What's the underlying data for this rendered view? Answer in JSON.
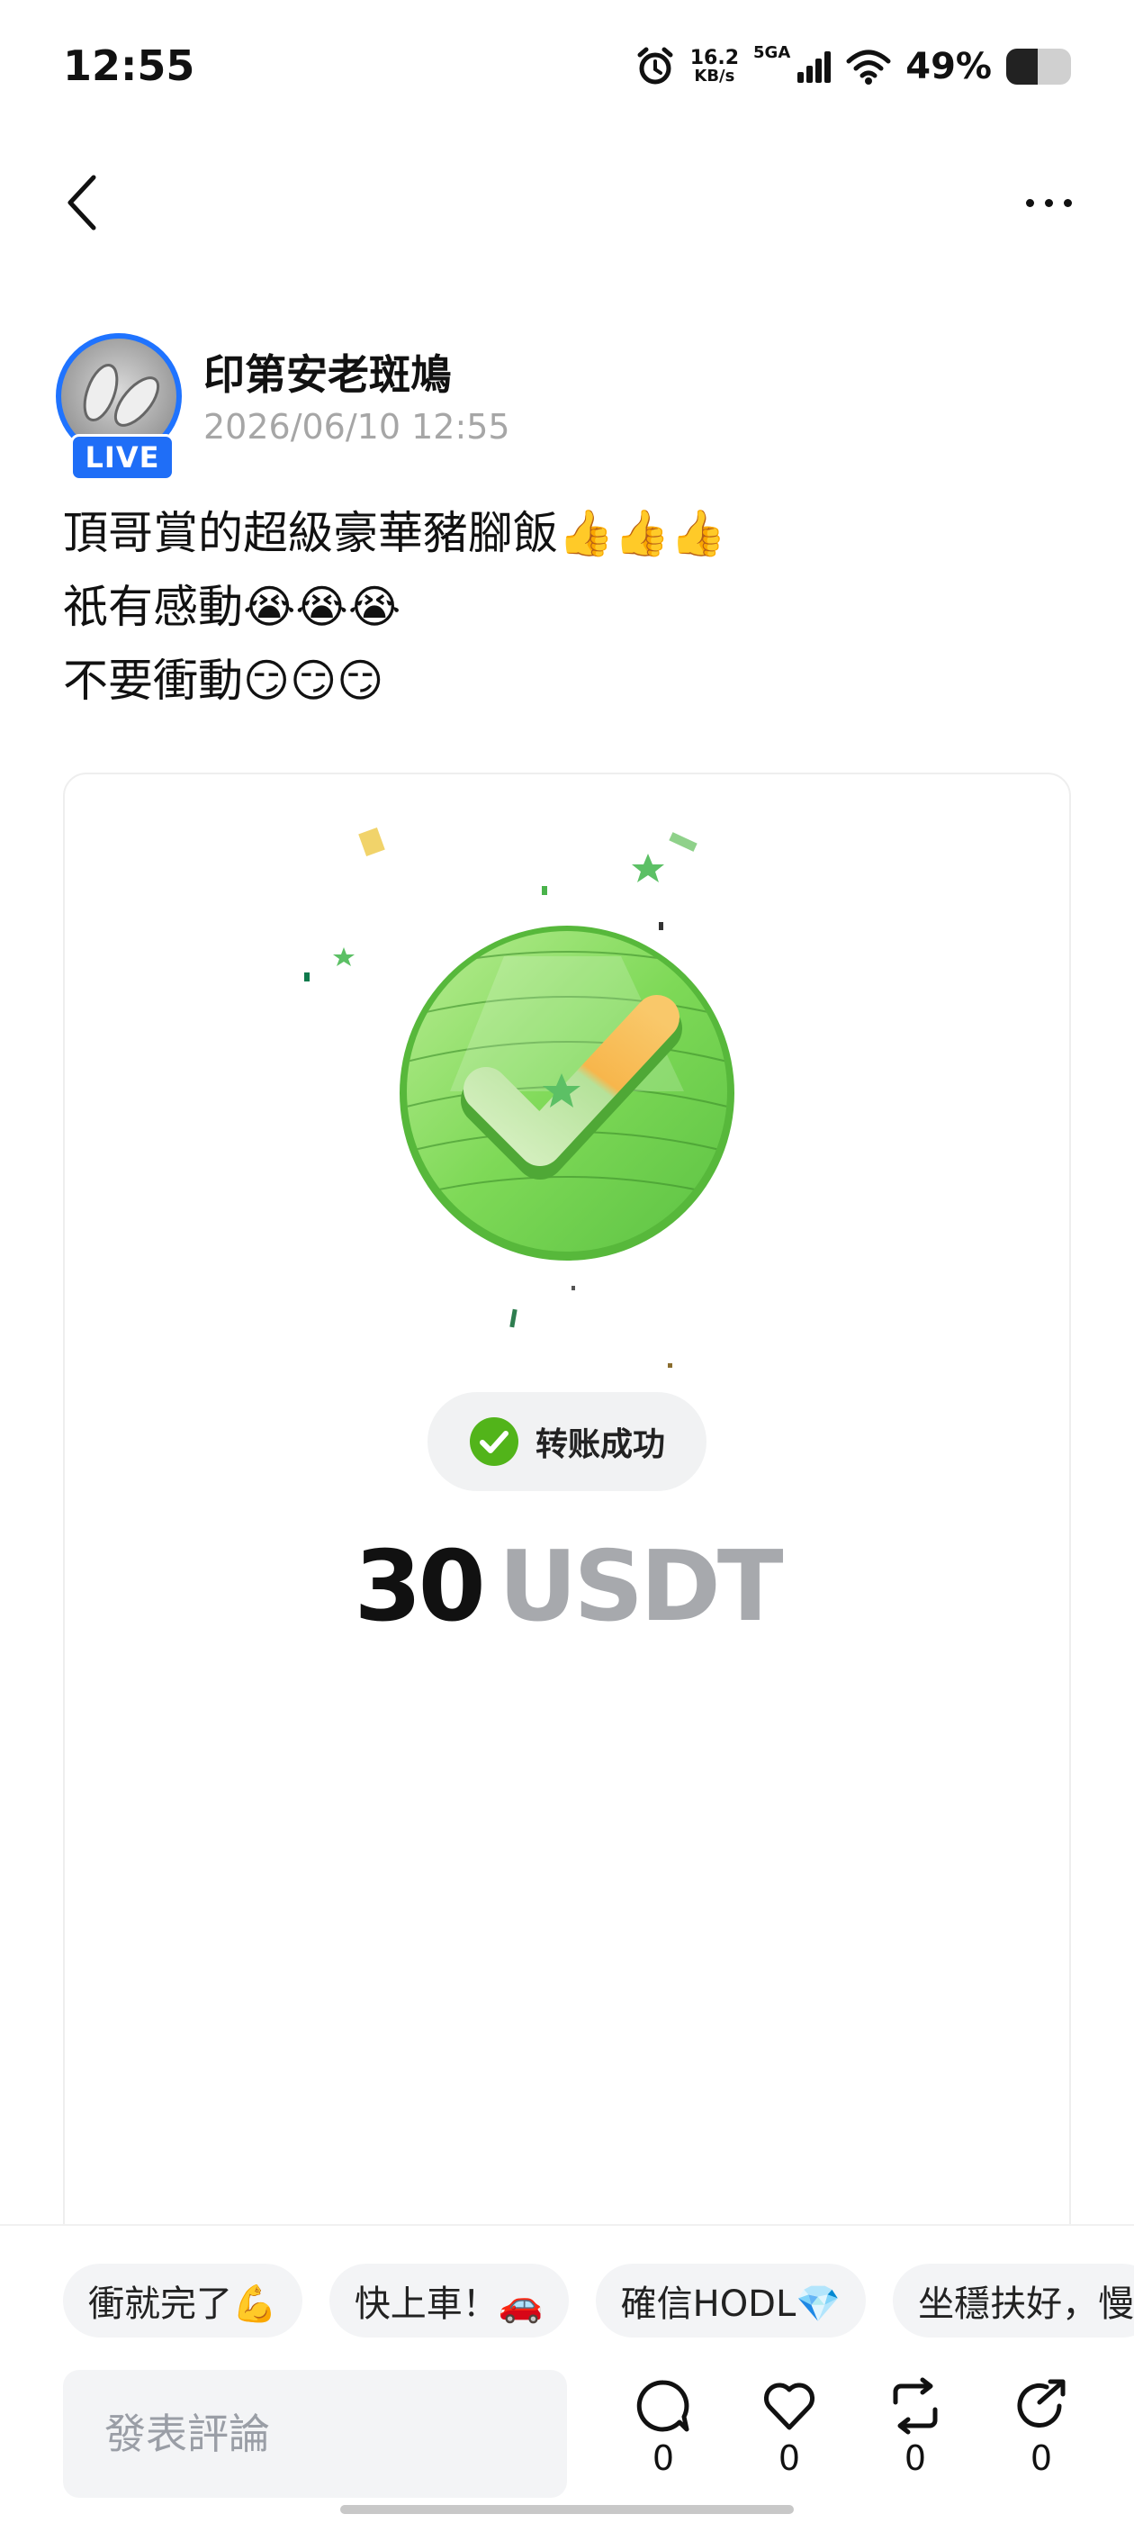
{
  "status_bar": {
    "time": "12:55",
    "net_speed_value": "16.2",
    "net_speed_unit": "KB/s",
    "network_type": "5GA",
    "battery_percent": "49%",
    "battery_level": 0.49,
    "icons": [
      "alarm-icon",
      "signal-icon",
      "wifi-icon",
      "battery-icon"
    ]
  },
  "nav": {
    "back_icon": "chevron-left-icon",
    "more_icon": "more-dots-icon"
  },
  "author": {
    "name": "印第安老斑鳩",
    "timestamp": "2026/06/10 12:55",
    "live_badge": "LIVE"
  },
  "post": {
    "lines": [
      "頂哥賞的超級豪華豬腳飯👍👍👍",
      "祇有感動😭😭😭",
      "不要衝動😏😏😏"
    ]
  },
  "card": {
    "status_text": "转账成功",
    "amount_value": "30",
    "amount_unit": "USDT",
    "colors": {
      "coin_green": "#7ed957",
      "check_orange": "#f7b64c",
      "success_green": "#52b41a"
    }
  },
  "quick_replies": [
    "衝就完了💪",
    "快上車！🚗",
    "確信HODL💎",
    "坐穩扶好，慢"
  ],
  "comment": {
    "placeholder": "發表評論"
  },
  "actions": {
    "comment_count": "0",
    "like_count": "0",
    "repost_count": "0",
    "share_count": "0"
  },
  "colors": {
    "accent_blue": "#1f6ef7",
    "muted_text": "#a6a6a6"
  }
}
